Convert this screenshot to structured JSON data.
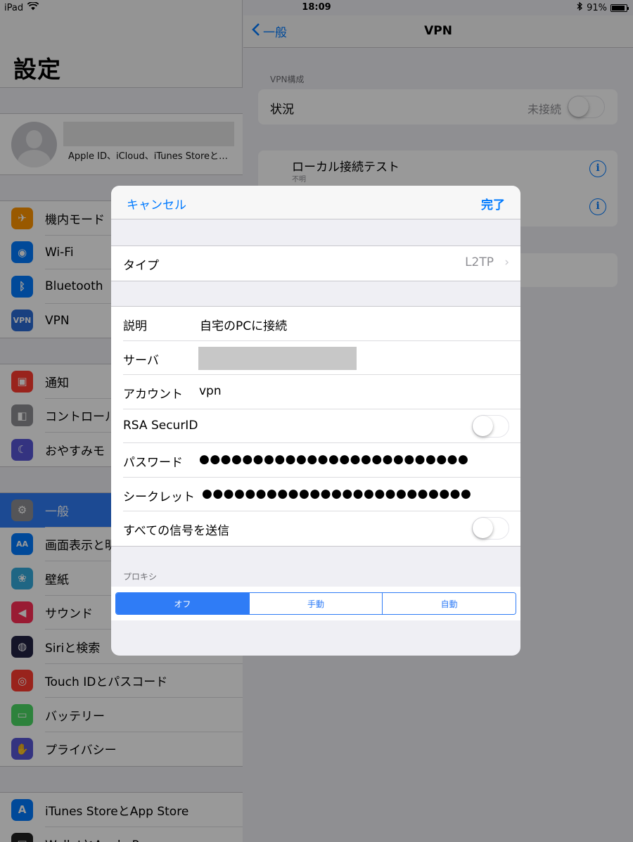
{
  "status_bar": {
    "device": "iPad",
    "time": "18:09",
    "battery": "91%",
    "battery_level": 0.91
  },
  "sidebar": {
    "title": "設定",
    "profile_subtitle": "Apple ID、iCloud、iTunes Storeと…",
    "group1": [
      {
        "label": "機内モード",
        "icon": "airplane-icon",
        "color": "#ff9500"
      },
      {
        "label": "Wi-Fi",
        "icon": "wifi-icon",
        "color": "#007aff"
      },
      {
        "label": "Bluetooth",
        "icon": "bluetooth-icon",
        "color": "#007aff"
      },
      {
        "label": "VPN",
        "icon": "vpn-icon",
        "color": "#2b6bd6"
      }
    ],
    "group2": [
      {
        "label": "通知",
        "icon": "notifications-icon",
        "color": "#ff3b30"
      },
      {
        "label": "コントロール",
        "icon": "control-center-icon",
        "color": "#8e8e93"
      },
      {
        "label": "おやすみモ",
        "icon": "moon-icon",
        "color": "#5856d6"
      }
    ],
    "group3": [
      {
        "label": "一般",
        "icon": "gear-icon",
        "color": "#8e8e93"
      },
      {
        "label": "画面表示と明",
        "icon": "display-icon",
        "color": "#007aff"
      },
      {
        "label": "壁紙",
        "icon": "wallpaper-icon",
        "color": "#34aadc"
      },
      {
        "label": "サウンド",
        "icon": "sound-icon",
        "color": "#ff2d55"
      },
      {
        "label": "Siriと検索",
        "icon": "siri-icon",
        "color": "#222244"
      },
      {
        "label": "Touch IDとパスコード",
        "icon": "fingerprint-icon",
        "color": "#ff3b30"
      },
      {
        "label": "バッテリー",
        "icon": "battery-icon",
        "color": "#4cd964"
      },
      {
        "label": "プライバシー",
        "icon": "hand-icon",
        "color": "#5856d6"
      }
    ],
    "group4": [
      {
        "label": "iTunes StoreとApp Store",
        "icon": "app-store-icon",
        "color": "#007aff"
      },
      {
        "label": "WalletとApple Pay",
        "icon": "wallet-icon",
        "color": "#222222"
      }
    ]
  },
  "detail": {
    "back_label": "一般",
    "title": "VPN",
    "section_header": "VPN構成",
    "status_label": "状況",
    "status_value": "未接続",
    "config_name": "ローカル接続テスト",
    "config_sub": "不明"
  },
  "modal": {
    "cancel": "キャンセル",
    "done": "完了",
    "type_label": "タイプ",
    "type_value": "L2TP",
    "chevron": "›",
    "fields": {
      "description_label": "説明",
      "description_value": "自宅のPCに接続",
      "server_label": "サーバ",
      "account_label": "アカウント",
      "account_value": "vpn",
      "rsa_label": "RSA SecurID",
      "password_label": "パスワード",
      "password_value": "●●●●●●●●●●●●●●●●●●●●●●●●●",
      "secret_label": "シークレット",
      "secret_value": "●●●●●●●●●●●●●●●●●●●●●●●●●",
      "send_all_label": "すべての信号を送信"
    },
    "proxy": {
      "header": "プロキシ",
      "options": [
        "オフ",
        "手動",
        "自動"
      ],
      "selected": 0
    }
  }
}
